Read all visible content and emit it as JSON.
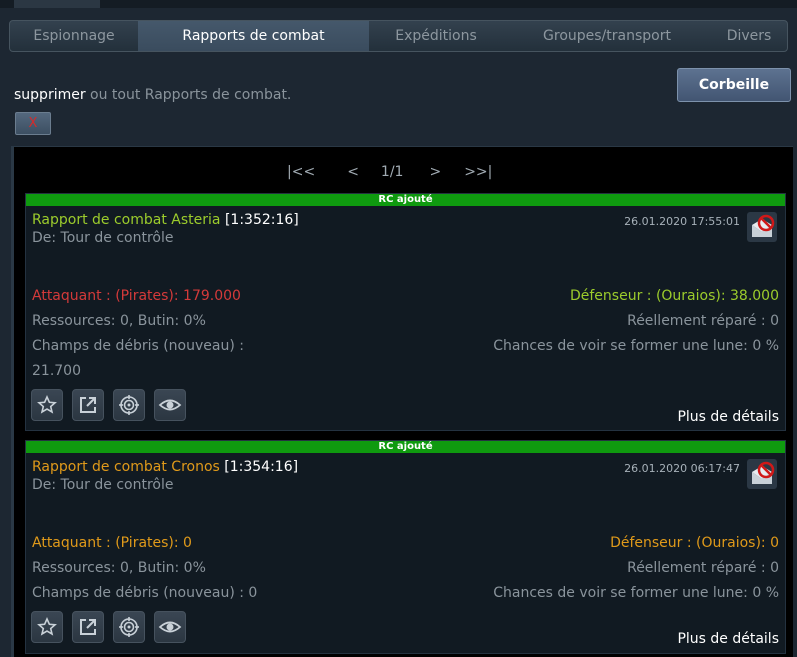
{
  "tabs": [
    {
      "label": "Espionnage",
      "active": false
    },
    {
      "label": "Rapports de combat",
      "active": true
    },
    {
      "label": "Expéditions",
      "active": false
    },
    {
      "label": "Groupes/transport",
      "active": false
    },
    {
      "label": "Divers",
      "active": false
    }
  ],
  "actions_bar": {
    "delete_link": "supprimer",
    "delete_rest": " ou tout Rapports de combat.",
    "delete_button": "X",
    "trash_button": "Corbeille"
  },
  "pagination": {
    "first": "|<<",
    "prev": "<",
    "pages": "1/1",
    "next": ">",
    "last": ">>|"
  },
  "messages": [
    {
      "badge": "RC ajouté",
      "title": "Rapport de combat Asteria",
      "coords": "[1:352:16]",
      "from": "De: Tour de contrôle",
      "date": "26.01.2020 17:55:01",
      "attacker": "Attaquant : (Pirates): 179.000",
      "defender": "Défenseur : (Ouraios): 38.000",
      "resources": "Ressources: 0, Butin: 0%",
      "repaired": "Réellement réparé : 0",
      "debris_label": "Champs de débris (nouveau) :",
      "debris_value": "21.700",
      "moon": "Chances de voir se former une lune: 0 %",
      "more": "Plus de détails",
      "colors": {
        "title": "#9ccc2c",
        "attacker": "#d43a3a",
        "defender": "#9ccc2c"
      }
    },
    {
      "badge": "RC ajouté",
      "title": "Rapport de combat Cronos",
      "coords": "[1:354:16]",
      "from": "De: Tour de contrôle",
      "date": "26.01.2020 06:17:47",
      "attacker": "Attaquant : (Pirates): 0",
      "defender": "Défenseur : (Ouraios): 0",
      "resources": "Ressources: 0, Butin: 0%",
      "repaired": "Réellement réparé : 0",
      "debris": "Champs de débris (nouveau) : 0",
      "moon": "Chances de voir se former une lune: 0 %",
      "more": "Plus de détails",
      "colors": {
        "title": "#e09a1a",
        "attacker": "#e09a1a",
        "defender": "#e09a1a"
      }
    }
  ],
  "icons": [
    "star-icon",
    "share-icon",
    "target-icon",
    "eye-icon",
    "delete-message-icon"
  ]
}
